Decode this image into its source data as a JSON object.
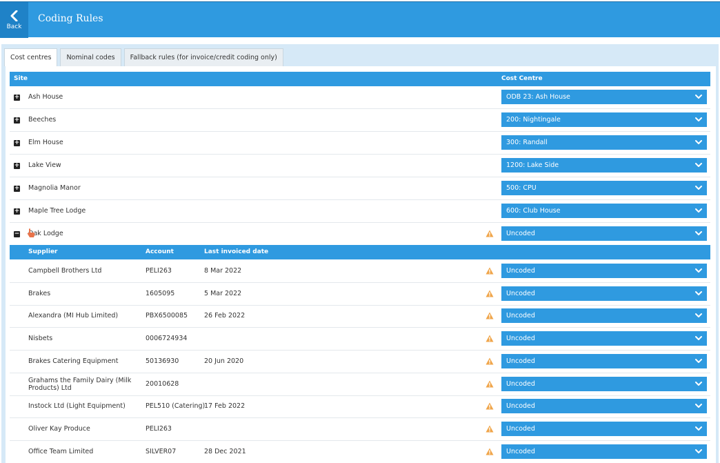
{
  "header": {
    "back_label": "Back",
    "title": "Coding Rules"
  },
  "tabs": [
    {
      "label": "Cost centres",
      "active": true
    },
    {
      "label": "Nominal codes",
      "active": false
    },
    {
      "label": "Fallback rules (for invoice/credit coding only)",
      "active": false
    }
  ],
  "site_table": {
    "col_site": "Site",
    "col_cost_centre": "Cost Centre",
    "rows": [
      {
        "site": "Ash House",
        "cost_centre": "ODB 23: Ash House"
      },
      {
        "site": "Beeches",
        "cost_centre": "200: Nightingale"
      },
      {
        "site": "Elm House",
        "cost_centre": "300: Randall"
      },
      {
        "site": "Lake View",
        "cost_centre": "1200: Lake Side"
      },
      {
        "site": "Magnolia Manor",
        "cost_centre": "500: CPU"
      },
      {
        "site": "Maple Tree Lodge",
        "cost_centre": "600: Club House"
      },
      {
        "site": "Oak Lodge",
        "cost_centre": "Uncoded"
      }
    ]
  },
  "supplier_table": {
    "col_supplier": "Supplier",
    "col_account": "Account",
    "col_last_invoiced": "Last invoiced date",
    "rows": [
      {
        "supplier": "Campbell Brothers Ltd",
        "account": "PELI263",
        "date": "8 Mar 2022",
        "cost_centre": "Uncoded"
      },
      {
        "supplier": "Brakes",
        "account": "1605095",
        "date": "5 Mar 2022",
        "cost_centre": "Uncoded"
      },
      {
        "supplier": "Alexandra (MI Hub Limited)",
        "account": "PBX6500085",
        "date": "26 Feb 2022",
        "cost_centre": "Uncoded"
      },
      {
        "supplier": "Nisbets",
        "account": "0006724934",
        "date": "",
        "cost_centre": "Uncoded"
      },
      {
        "supplier": "Brakes Catering Equipment",
        "account": "50136930",
        "date": "20 Jun 2020",
        "cost_centre": "Uncoded"
      },
      {
        "supplier": "Grahams the Family Dairy (Milk Products) Ltd",
        "account": "20010628",
        "date": "",
        "cost_centre": "Uncoded"
      },
      {
        "supplier": "Instock Ltd (Light Equipment)",
        "account": "PEL510 (Catering)",
        "date": "17 Feb 2022",
        "cost_centre": "Uncoded"
      },
      {
        "supplier": "Oliver Kay Produce",
        "account": "PELI263",
        "date": "",
        "cost_centre": "Uncoded"
      },
      {
        "supplier": "Office Team Limited",
        "account": "SILVER07",
        "date": "28 Dec 2021",
        "cost_centre": "Uncoded"
      }
    ]
  },
  "icons": {
    "expand": "plus-square-icon",
    "collapse": "minus-square-icon",
    "warning": "warning-triangle-icon",
    "dropdown": "chevron-down-icon",
    "back": "chevron-left-icon"
  },
  "colors": {
    "primary": "#2f9ae0",
    "back_button": "#1f82c7",
    "panel_bg": "#d6e9f7",
    "warning": "#f0a54a"
  }
}
